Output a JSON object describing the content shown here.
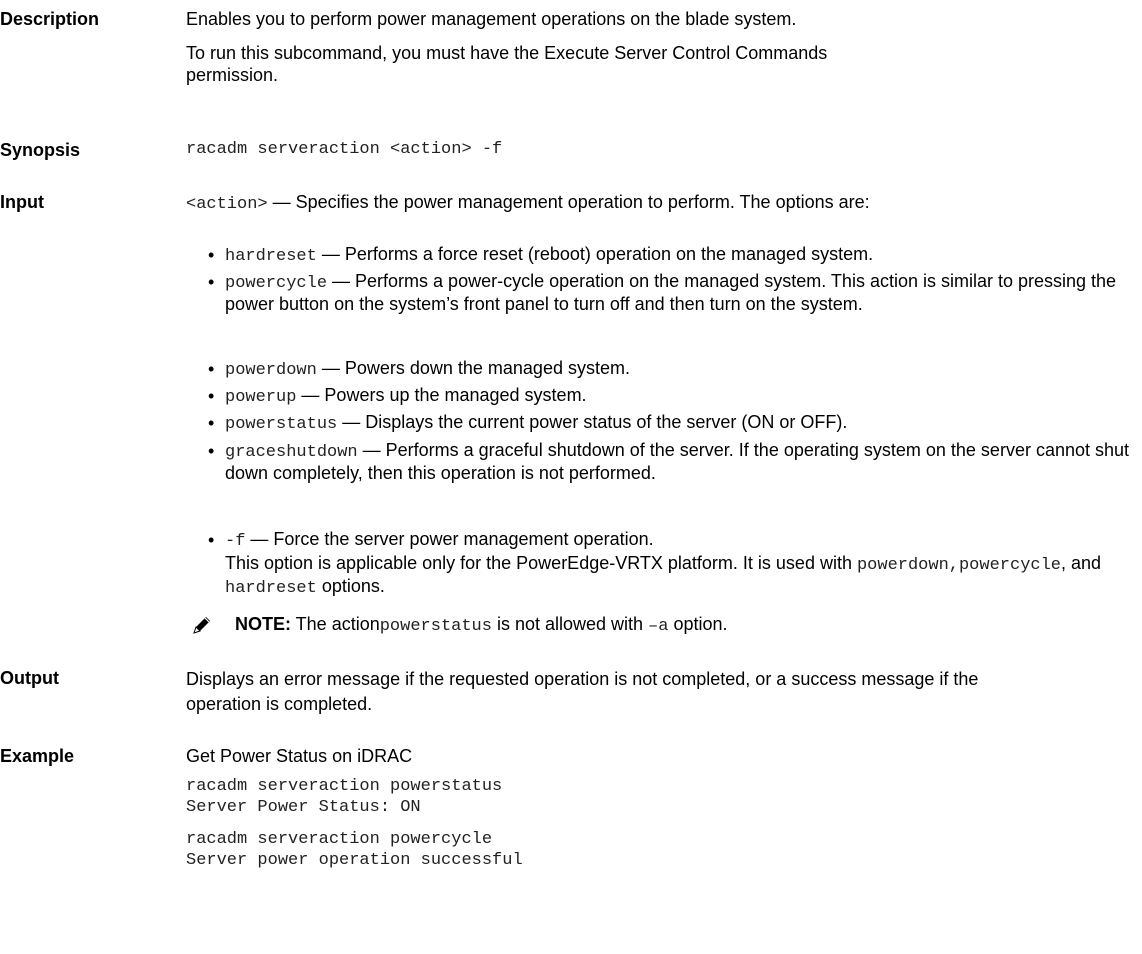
{
  "description": {
    "label": "Description",
    "line1": "Enables you to perform power management operations on the blade system.",
    "line2": "To run this subcommand, you must have the Execute Server Control Commands permission."
  },
  "synopsis": {
    "label": "Synopsis",
    "command": "racadm serveraction <action> -f"
  },
  "input": {
    "label": "Input",
    "intro_code": "<action>",
    "intro_text": " — Specifies the power management operation to perform. The options are:",
    "options": [
      {
        "code": "hardreset",
        "text": " — Performs a force reset (reboot) operation on the managed system."
      },
      {
        "code": "powercycle",
        "text": " — Performs a power-cycle operation on the managed system. This action is similar to pressing the power button on the system’s front panel to turn off and then turn on the system."
      },
      {
        "code": "powerdown",
        "text": " — Powers down the managed system."
      },
      {
        "code": "powerup",
        "text": " — Powers up the managed system."
      },
      {
        "code": "powerstatus",
        "text": " — Displays the current power status of the server (ON or OFF)."
      },
      {
        "code": "graceshutdown",
        "text": " — Performs a graceful shutdown of the server. If the operating system on the server cannot shut down completely, then this operation is not performed."
      },
      {
        "code": "-f",
        "text": " — Force the server power management operation."
      }
    ],
    "force_note_text": "This option is applicable only for the PowerEdge-VRTX platform. It is used with ",
    "force_note_code1": "powerdown,powercycle",
    "force_note_mid": ", and ",
    "force_note_code2": "hardreset",
    "force_note_end": " options.",
    "note_label": "NOTE:",
    "note_text1": " The action",
    "note_code1": "powerstatus",
    "note_text2": " is not allowed with ",
    "note_code2": "–a",
    "note_text3": " option."
  },
  "output": {
    "label": "Output",
    "text": "Displays an error message if the requested operation is not completed, or a success message if the operation is completed."
  },
  "example": {
    "label": "Example",
    "title": "Get Power Status on iDRAC",
    "code1_line1": "racadm serveraction powerstatus",
    "code1_line2": "Server Power Status: ON",
    "code2_line1": "racadm serveraction powercycle",
    "code2_line2": "Server power operation successful"
  }
}
